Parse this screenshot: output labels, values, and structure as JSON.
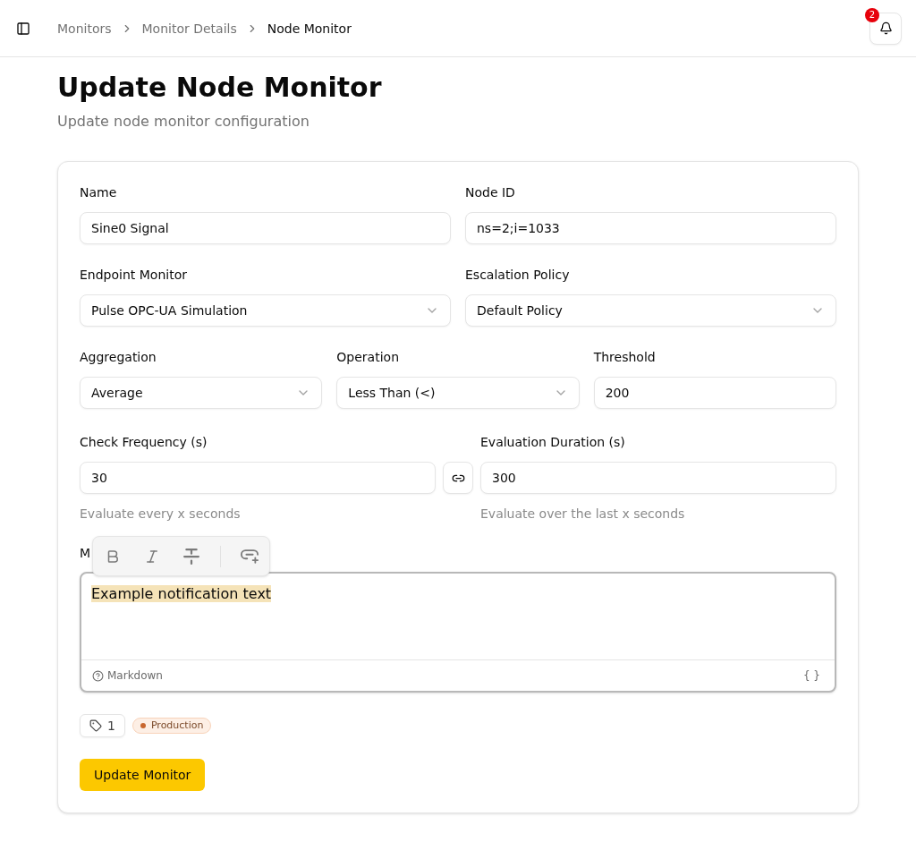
{
  "header": {
    "breadcrumbs": [
      {
        "label": "Monitors",
        "current": false
      },
      {
        "label": "Monitor Details",
        "current": false
      },
      {
        "label": "Node Monitor",
        "current": true
      }
    ],
    "notification_count": "2"
  },
  "page": {
    "title": "Update Node Monitor",
    "subtitle": "Update node monitor configuration"
  },
  "form": {
    "rows": [
      {
        "fields": [
          {
            "label": "Name",
            "kind": "input",
            "value": "Sine0 Signal"
          },
          {
            "label": "Node ID",
            "kind": "input",
            "value": "ns=2;i=1033"
          }
        ]
      },
      {
        "fields": [
          {
            "label": "Endpoint Monitor",
            "kind": "select",
            "value": "Pulse OPC-UA Simulation"
          },
          {
            "label": "Escalation Policy",
            "kind": "select",
            "value": "Default Policy"
          }
        ]
      },
      {
        "fields": [
          {
            "label": "Aggregation",
            "kind": "select",
            "value": "Average"
          },
          {
            "label": "Operation",
            "kind": "select",
            "value": "Less Than (<)"
          },
          {
            "label": "Threshold",
            "kind": "input",
            "value": "200"
          }
        ]
      }
    ],
    "timing": [
      {
        "label": "Check Frequency (s)",
        "value": "30",
        "hint": "Evaluate every x seconds"
      },
      {
        "label": "Evaluation Duration (s)",
        "value": "300",
        "hint": "Evaluate over the last x seconds"
      }
    ],
    "message": {
      "label": "M",
      "text": "Example notification text",
      "highlighted": true,
      "footer": {
        "help": "Markdown",
        "variables": "{ }"
      }
    },
    "tags": {
      "count": "1",
      "labels": [
        {
          "label": "Production",
          "color": "#c8672f"
        }
      ]
    },
    "submit": "Update Monitor"
  }
}
